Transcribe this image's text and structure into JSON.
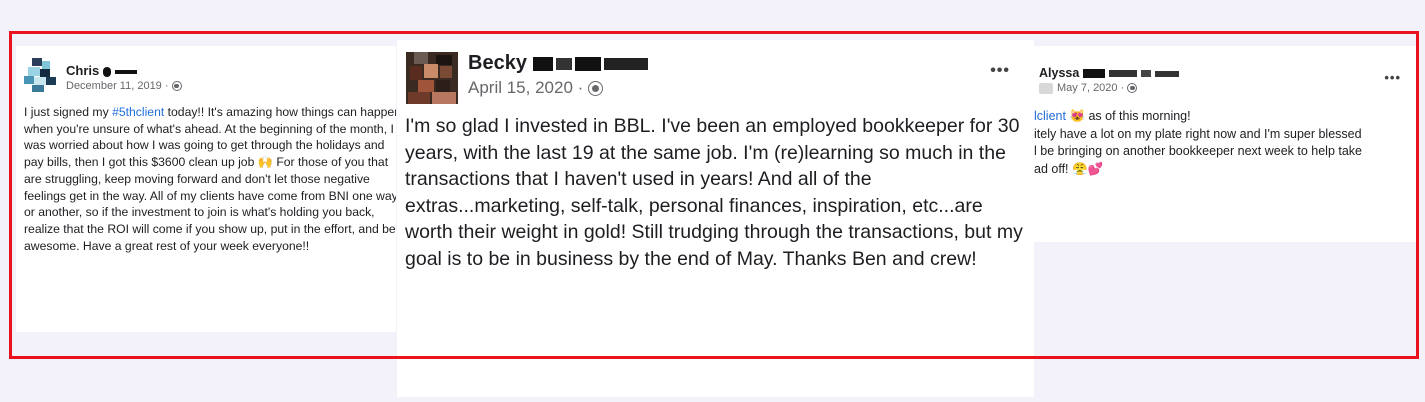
{
  "colors": {
    "frame": "#e8131f",
    "hashtag": "#216fdb",
    "meta": "#65676b",
    "background": "#f3f2fb"
  },
  "left": {
    "name": "Chris",
    "date": "December 11, 2019 ·",
    "post_before": "I just signed my ",
    "hashtag": "#5thclient",
    "post_after": " today!! It's amazing how things can happen when you're unsure of what's ahead. At the beginning of the month, I was worried about how I was going to get through the holidays and pay bills, then I got this $3600 clean up job 🙌 For those of you that are struggling, keep moving forward and don't let those negative feelings get in the way. All of my clients have come from BNI one way or another, so if the investment to join is what's holding you back, realize that the ROI will come if you show up, put in the effort, and be awesome. Have a great rest of your week everyone!!"
  },
  "middle": {
    "name": "Becky",
    "date": "April 15, 2020 ·",
    "more": "•••",
    "post": "I'm so glad I invested in BBL.  I've been an employed bookkeeper for 30 years, with the last 19 at the same job.  I'm (re)learning so much in the transactions that I haven't used in years!  And all of the extras...marketing, self-talk, personal finances, inspiration, etc...are worth their weight in gold!  Still trudging through the transactions, but my goal is to be in business by the end of May.  Thanks Ben and crew!"
  },
  "right": {
    "name": "Alyssa",
    "date": "May 7, 2020 ·",
    "more": "•••",
    "hashtag": "lclient",
    "line1_after": " 😻 as of this morning!",
    "line2": "itely have a lot on my plate right now and I'm super blessed",
    "line3": "l be bringing on another bookkeeper next week to help take",
    "line4": "ad off! 😤💕"
  }
}
